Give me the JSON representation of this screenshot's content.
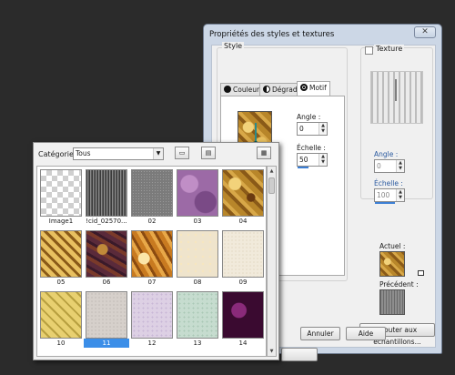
{
  "dialog": {
    "title": "Propriétés des styles et textures",
    "close_glyph": "✕",
    "style_group_label": "Style",
    "tabs": [
      {
        "label": "Couleur",
        "icon": "solid-color-icon"
      },
      {
        "label": "Dégradé",
        "icon": "gradient-icon"
      },
      {
        "label": "Motif",
        "icon": "pattern-icon",
        "active": true
      }
    ],
    "angle_label": "Angle :",
    "angle_value": "0",
    "scale_label": "Échelle :",
    "scale_value": "50",
    "texture_label": "Texture",
    "texture_checked": false,
    "texture_angle_label": "Angle :",
    "texture_angle_value": "0",
    "texture_scale_label": "Échelle :",
    "texture_scale_value": "100",
    "current_label": "Actuel :",
    "previous_label": "Précédent :",
    "add_samples_button": "Ajouter aux échantillons...",
    "cancel_button": "Annuler",
    "help_button": "Aide",
    "colors": {
      "titlebar": "#ccd7e6",
      "accent": "#3b8ee8"
    }
  },
  "picker": {
    "category_label": "Catégorie :",
    "category_value": "Tous",
    "textures": [
      {
        "label": "Image1",
        "pattern": "checker"
      },
      {
        "label": "!cid_02570...",
        "pattern": "stripes"
      },
      {
        "label": "02",
        "pattern": "gray-noise"
      },
      {
        "label": "03",
        "pattern": "purple"
      },
      {
        "label": "04",
        "pattern": "gold-swirl"
      },
      {
        "label": "05",
        "pattern": "gold-diamond"
      },
      {
        "label": "06",
        "pattern": "brown-purple"
      },
      {
        "label": "07",
        "pattern": "orange-swirl"
      },
      {
        "label": "08",
        "pattern": "cream-lace"
      },
      {
        "label": "09",
        "pattern": "beige-speckle"
      },
      {
        "label": "10",
        "pattern": "yellow-quilt"
      },
      {
        "label": "11",
        "pattern": "gray-marble",
        "selected": true
      },
      {
        "label": "12",
        "pattern": "lilac-marble"
      },
      {
        "label": "13",
        "pattern": "mint-marble"
      },
      {
        "label": "14",
        "pattern": "dark-purple"
      }
    ]
  }
}
